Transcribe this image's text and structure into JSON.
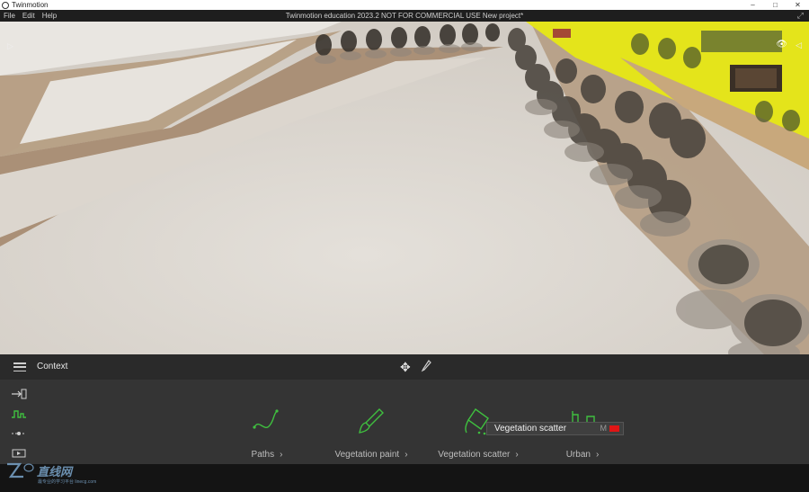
{
  "window": {
    "app_name": "Twinmotion",
    "controls": [
      "–",
      "□",
      "✕"
    ]
  },
  "menubar": {
    "items": [
      "File",
      "Edit",
      "Help"
    ],
    "title": "Twinmotion education 2023.2   NOT FOR COMMERCIAL USE   New project*",
    "expand_glyph": "⤢"
  },
  "viewport": {
    "left_arrow": "▷",
    "eye_icon": "👁",
    "right_arrow": "◁"
  },
  "context_bar": {
    "label": "Context",
    "move_glyph": "✥"
  },
  "categories": [
    {
      "label": "Paths",
      "chevron": "›"
    },
    {
      "label": "Vegetation paint",
      "chevron": "›"
    },
    {
      "label": "Vegetation scatter",
      "chevron": "›"
    },
    {
      "label": "Urban",
      "chevron": "›"
    }
  ],
  "tooltip": {
    "text": "Vegetation scatter",
    "shortcut": "M"
  },
  "watermark": {
    "text": "直线网",
    "sub": "最专业的学习平台 linecg.com"
  },
  "colors": {
    "accent_green": "#3fbf3f",
    "grass_yellow": "#e6e61a",
    "record_red": "#e01515"
  }
}
